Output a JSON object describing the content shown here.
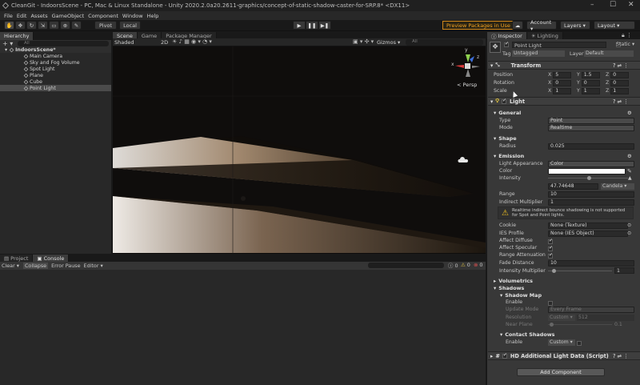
{
  "titlebar": {
    "title": "CleanGit - IndoorsScene - PC, Mac & Linux Standalone - Unity 2020.2.0a20.2611-graphics/concept-of-static-shadow-caster-for-SRP.8* <DX11>"
  },
  "menu": [
    "File",
    "Edit",
    "Assets",
    "GameObject",
    "Component",
    "Window",
    "Help"
  ],
  "toolbar": {
    "pivot": "Pivot",
    "local": "Local",
    "preview_packages": "Preview Packages in Use ▾",
    "account": "Account ▾",
    "layers": "Layers ▾",
    "layout": "Layout ▾"
  },
  "hierarchy": {
    "tab": "Hierarchy",
    "search_placeholder": "All",
    "scene": "IndoorsScene*",
    "items": [
      "Main Camera",
      "Sky and Fog Volume",
      "Spot Light",
      "Plane",
      "Cube",
      "Point Light"
    ]
  },
  "center_tabs": [
    "Scene",
    "Game",
    "Package Manager"
  ],
  "scene_toolbar": {
    "shading": "Shaded",
    "mode": "2D",
    "gizmos": "Gizmos ▾",
    "search": "All"
  },
  "scene_view": {
    "persp": "< Persp",
    "axis_y": "y",
    "axis_x": "x",
    "axis_z": "z"
  },
  "project": {
    "tabs": [
      "Project",
      "Console"
    ],
    "buttons": [
      "Clear ▾",
      "Collapse",
      "Error Pause",
      "Editor ▾"
    ],
    "counts": [
      "0",
      "0",
      "0"
    ]
  },
  "inspector": {
    "tabs": [
      "Inspector",
      "Lighting"
    ],
    "object_name": "Point Light",
    "static_label": "Static ▾",
    "tag_label": "Tag",
    "tag_value": "Untagged",
    "layer_label": "Layer",
    "layer_value": "Default",
    "transform": {
      "title": "Transform",
      "rows": [
        {
          "label": "Position",
          "x": "5",
          "y": "1.5",
          "z": "0"
        },
        {
          "label": "Rotation",
          "x": "0",
          "y": "0",
          "z": "0"
        },
        {
          "label": "Scale",
          "x": "1",
          "y": "1",
          "z": "1"
        }
      ]
    },
    "light": {
      "title": "Light",
      "general": "General",
      "type_label": "Type",
      "type_value": "Point",
      "mode_label": "Mode",
      "mode_value": "Realtime",
      "shape": "Shape",
      "radius_label": "Radius",
      "radius_value": "0.025",
      "emission": "Emission",
      "appearance_label": "Light Appearance",
      "appearance_value": "Color",
      "color_label": "Color",
      "intensity_label": "Intensity",
      "intensity_value": "47.74648",
      "intensity_unit": "Candela ▾",
      "range_label": "Range",
      "range_value": "10",
      "indirect_label": "Indirect Multiplier",
      "indirect_value": "1",
      "warning": "Realtime indirect bounce shadowing is not supported for Spot and Point lights.",
      "cookie_label": "Cookie",
      "cookie_value": "None (Texture)",
      "ies_label": "IES Profile",
      "ies_value": "None (IES Object)",
      "affect_diffuse": "Affect Diffuse",
      "affect_specular": "Affect Specular",
      "range_atten": "Range Attenuation",
      "fade_label": "Fade Distance",
      "fade_value": "10",
      "int_mult_label": "Intensity Multiplier",
      "int_mult_value": "1",
      "volumetrics": "Volumetrics",
      "shadows": "Shadows",
      "shadow_map": "Shadow Map",
      "enable": "Enable",
      "update_mode": "Update Mode",
      "update_value": "Every Frame",
      "resolution": "Resolution",
      "res_preset": "Custom ▾",
      "res_value": "512",
      "near_plane": "Near Plane",
      "near_value": "0.1",
      "contact": "Contact Shadows",
      "contact_enable": "Enable",
      "contact_value": "Custom ▾"
    },
    "hd_title": "HD Additional Light Data (Script)",
    "add_component": "Add Component"
  },
  "colors": {
    "accent": "#f0a020",
    "selection": "#4b4b4b",
    "panel": "#383838"
  }
}
